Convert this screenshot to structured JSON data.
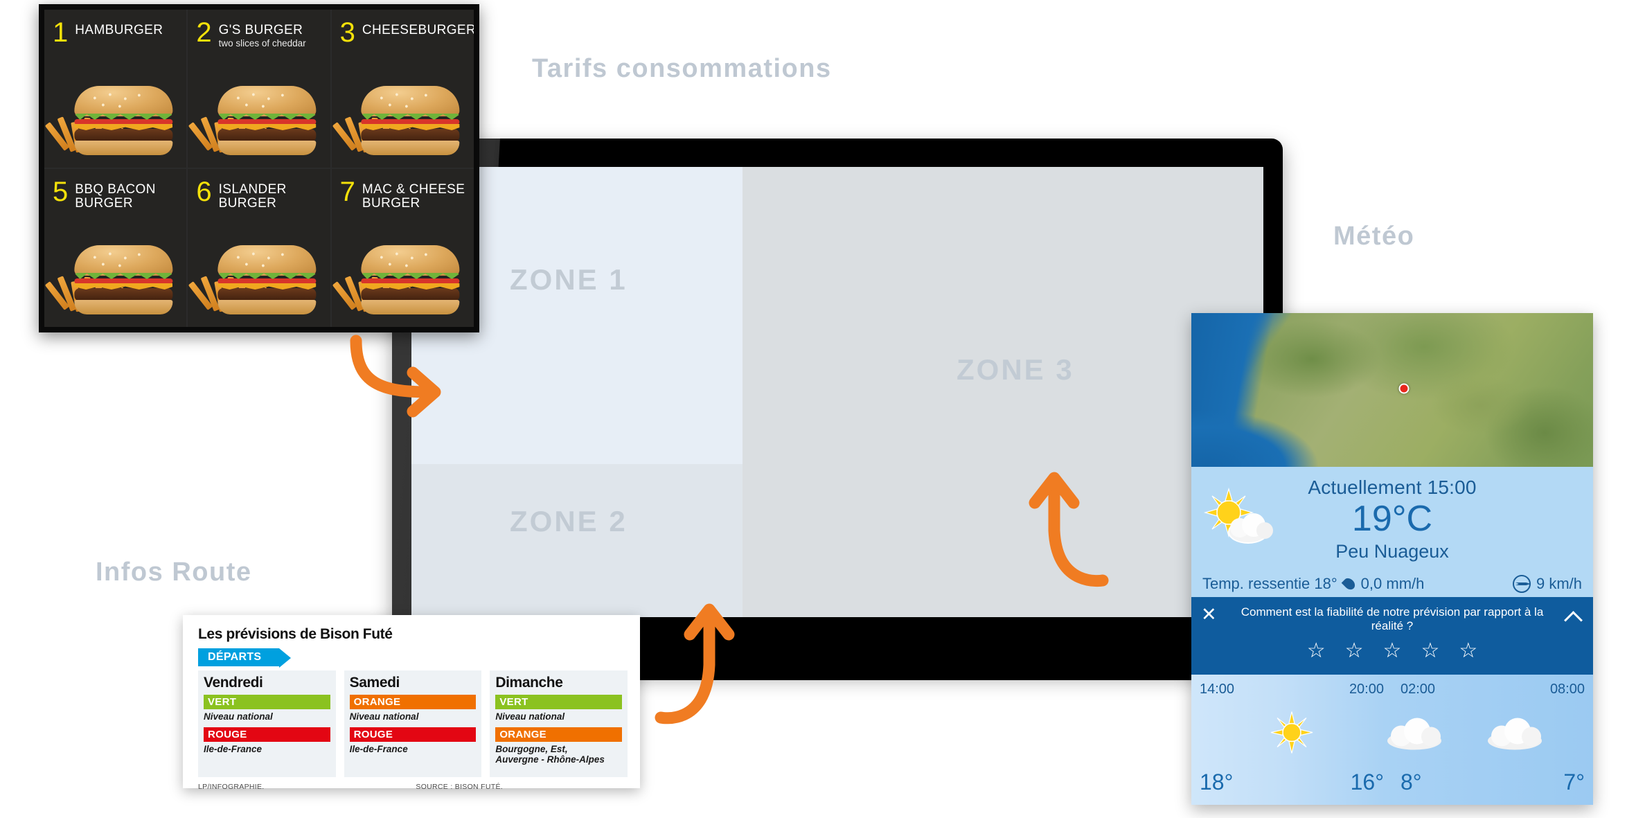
{
  "sections": {
    "tarifs_title": "Tarifs consommations",
    "meteo_title": "Météo",
    "infos_route_title": "Infos Route"
  },
  "monitor": {
    "zones": [
      {
        "id": "zone1",
        "label": "ZONE 1",
        "color": "#e7eef6"
      },
      {
        "id": "zone2",
        "label": "ZONE 2",
        "color": "#dfe5eb"
      },
      {
        "id": "zone3",
        "label": "ZONE 3",
        "color": "#dadee1"
      }
    ]
  },
  "menu_board": {
    "accent_color": "#f4e10a",
    "background": "#252422",
    "items": [
      {
        "num": "1",
        "name": "HAMBURGER",
        "sub": ""
      },
      {
        "num": "2",
        "name": "G'S BURGER",
        "sub": "two slices of cheddar"
      },
      {
        "num": "3",
        "name": "CHEESEBURGER",
        "sub": ""
      },
      {
        "num": "5",
        "name": "BBQ BACON BURGER",
        "sub": ""
      },
      {
        "num": "6",
        "name": "ISLANDER BURGER",
        "sub": ""
      },
      {
        "num": "7",
        "name": "MAC & CHEESE BURGER",
        "sub": ""
      }
    ]
  },
  "bison_fute": {
    "title": "Les prévisions de Bison Futé",
    "tag": "DÉPARTS",
    "tag_color": "#00a0df",
    "columns": [
      {
        "day": "Vendredi",
        "levels": [
          {
            "label": "VERT",
            "color": "#8bc220",
            "area": "Niveau national"
          },
          {
            "label": "ROUGE",
            "color": "#e30613",
            "area": "Ile-de-France"
          }
        ]
      },
      {
        "day": "Samedi",
        "levels": [
          {
            "label": "ORANGE",
            "color": "#f07000",
            "area": "Niveau national"
          },
          {
            "label": "ROUGE",
            "color": "#e30613",
            "area": "Ile-de-France"
          }
        ]
      },
      {
        "day": "Dimanche",
        "levels": [
          {
            "label": "VERT",
            "color": "#8bc220",
            "area": "Niveau national"
          },
          {
            "label": "ORANGE",
            "color": "#f07000",
            "area": "Bourgogne, Est,\nAuvergne - Rhône-Alpes"
          }
        ]
      }
    ],
    "credit": "LP/INFOGRAPHIE.",
    "source": "SOURCE : BISON FUTÉ."
  },
  "weather": {
    "now_label": "Actuellement 15:00",
    "temperature": "19°C",
    "condition": "Peu Nuageux",
    "feels_like": "Temp. ressentie 18°",
    "precipitation": "0,0 mm/h",
    "wind": "9 km/h",
    "icon_now": "sun-cloud-icon",
    "feedback": {
      "question": "Comment est la fiabilité de notre prévision par rapport à la réalité ?",
      "stars": [
        "☆",
        "☆",
        "☆",
        "☆",
        "☆"
      ],
      "close_icon": "close-icon",
      "collapse_icon": "chevron-up-icon"
    },
    "hourly": [
      {
        "time": "14:00",
        "temp": "18°",
        "icon": ""
      },
      {
        "time": "20:00",
        "temp": "16°",
        "icon": "sun-icon"
      },
      {
        "time": "02:00",
        "temp": "8°",
        "icon": "cloud-icon"
      },
      {
        "time": "08:00",
        "temp": "7°",
        "icon": "cloud-icon"
      }
    ],
    "map": {
      "marker_color": "#e8261c"
    }
  },
  "arrows": {
    "color": "#f07c22",
    "items": [
      {
        "name": "arrow-menu-to-zone1"
      },
      {
        "name": "arrow-bison-to-zone2"
      },
      {
        "name": "arrow-weather-to-zone3"
      }
    ]
  }
}
